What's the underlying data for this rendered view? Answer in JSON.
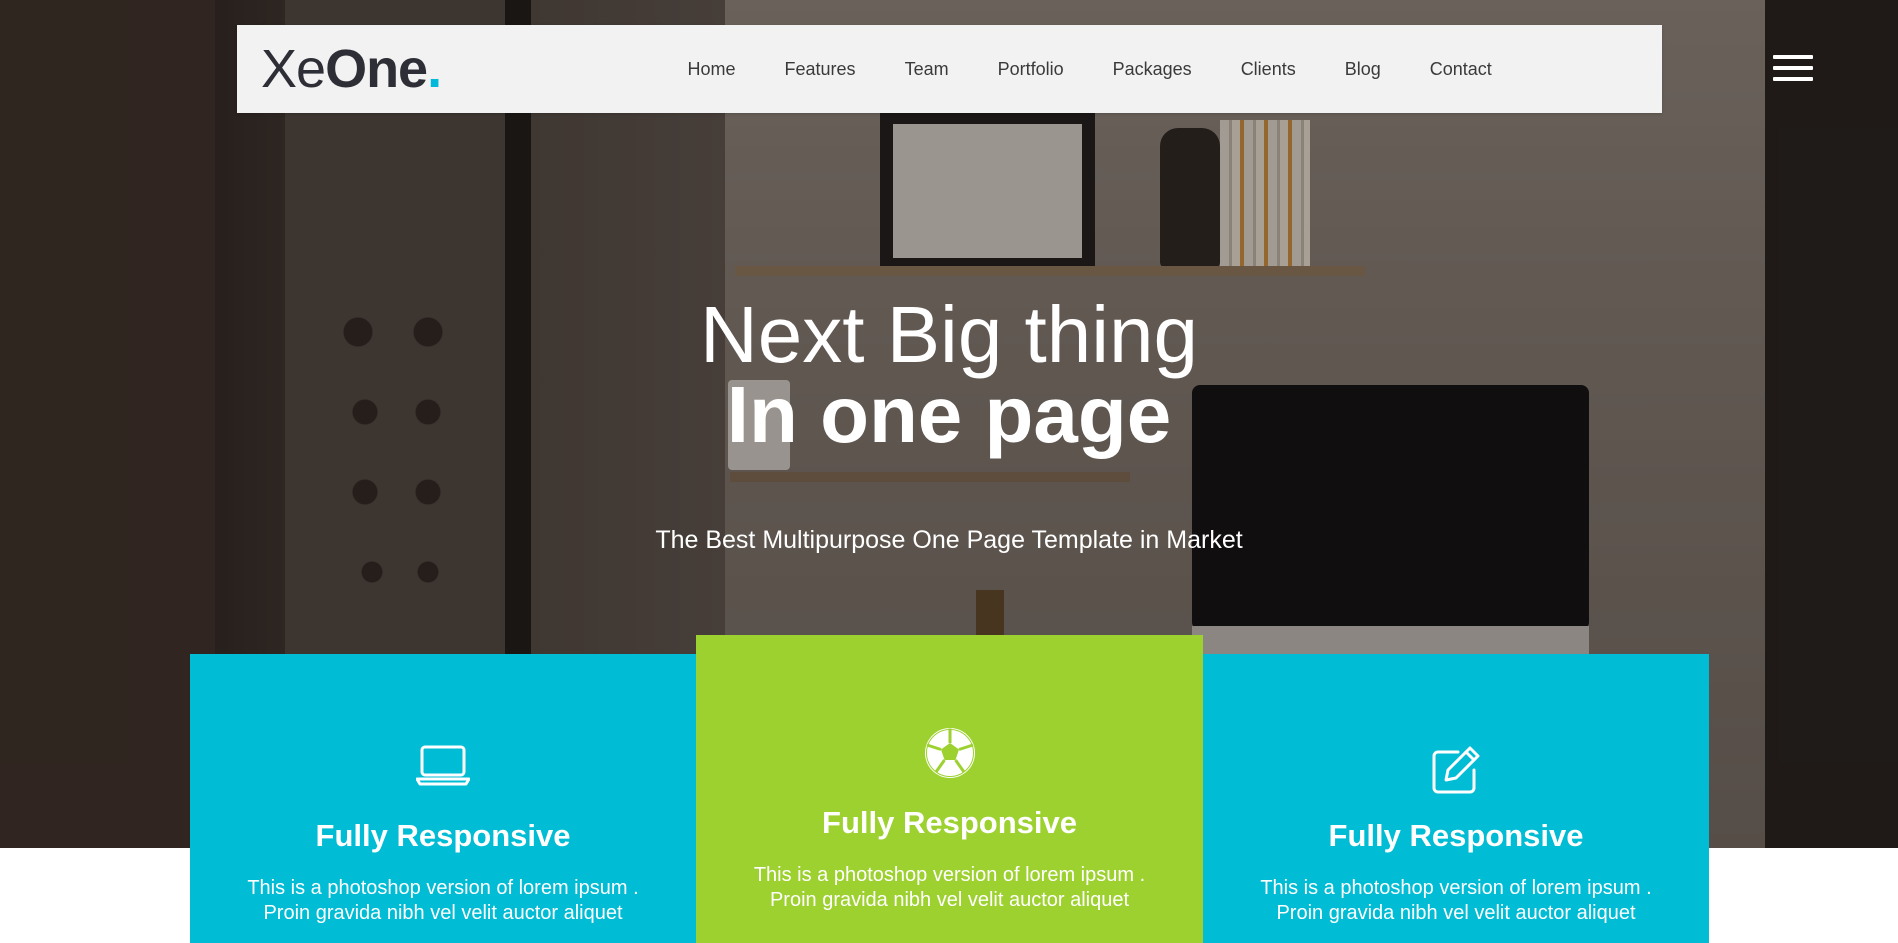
{
  "brand": {
    "logo_light": "Xe",
    "logo_bold": "One",
    "logo_dot": "."
  },
  "nav": {
    "items": [
      {
        "label": "Home"
      },
      {
        "label": "Features"
      },
      {
        "label": "Team"
      },
      {
        "label": "Portfolio"
      },
      {
        "label": "Packages"
      },
      {
        "label": "Clients"
      },
      {
        "label": "Blog"
      },
      {
        "label": "Contact"
      }
    ],
    "menu_icon": "hamburger-menu-icon"
  },
  "hero": {
    "title_line1": "Next Big thing",
    "title_line2": "In one page",
    "subtitle": "The Best Multipurpose One Page Template in Market"
  },
  "features": [
    {
      "icon": "laptop-icon",
      "title": "Fully Responsive",
      "line1": "This is a photoshop version of lorem ipsum .",
      "line2": "Proin gravida nibh vel velit auctor aliquet",
      "color": "#00bcd4"
    },
    {
      "icon": "soccer-ball-icon",
      "title": "Fully Responsive",
      "line1": "This is a photoshop version of lorem ipsum .",
      "line2": "Proin gravida nibh vel velit auctor aliquet",
      "color": "#9dd12f"
    },
    {
      "icon": "edit-icon",
      "title": "Fully Responsive",
      "line1": "This is a photoshop version of lorem ipsum .",
      "line2": "Proin gravida nibh vel velit auctor aliquet",
      "color": "#00bcd4"
    }
  ],
  "colors": {
    "accent": "#00b8d9",
    "card_blue": "#00bcd4",
    "card_green": "#9dd12f",
    "nav_bg": "#f2f2f2"
  }
}
